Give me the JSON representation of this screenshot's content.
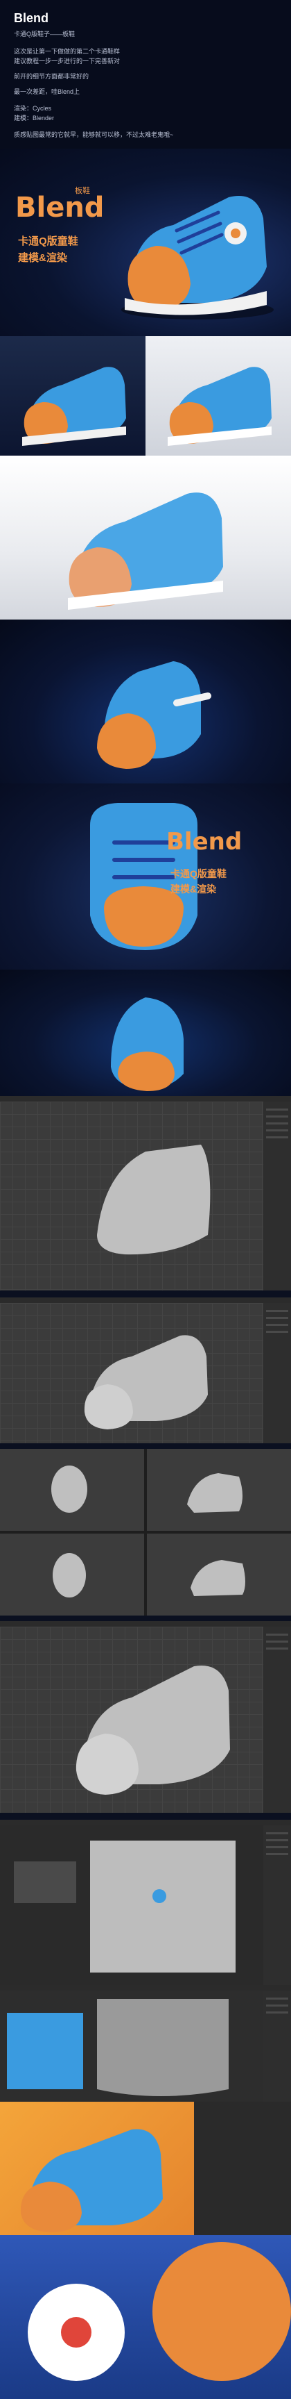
{
  "header": {
    "title": "Blend",
    "subtitle": "卡通Q版鞋子——板鞋",
    "paragraphs": [
      "这次是让第一下做做的第二个卡通鞋样",
      "建议教程一步一步进行的一下完善新对",
      "前开的细节方面都非常好的",
      "最一次差距，哇Blend上",
      "渲染：Cycles",
      "建模：Blender",
      "质感贴图最常的它就早，能够就可以移，不过太难老鬼哦~"
    ]
  },
  "hero": {
    "brand": "Blend",
    "tag": "板鞋",
    "line1": "卡通Q版童鞋",
    "line2": "建模&渲染"
  },
  "front": {
    "brand": "Blend",
    "line1": "卡通Q版童鞋",
    "line2": "建模&渲染"
  },
  "colors": {
    "accent": "#f2994a",
    "shoe_blue": "#3a9be0",
    "toe_orange": "#e98a3a",
    "sole_white": "#f1f1f1"
  }
}
